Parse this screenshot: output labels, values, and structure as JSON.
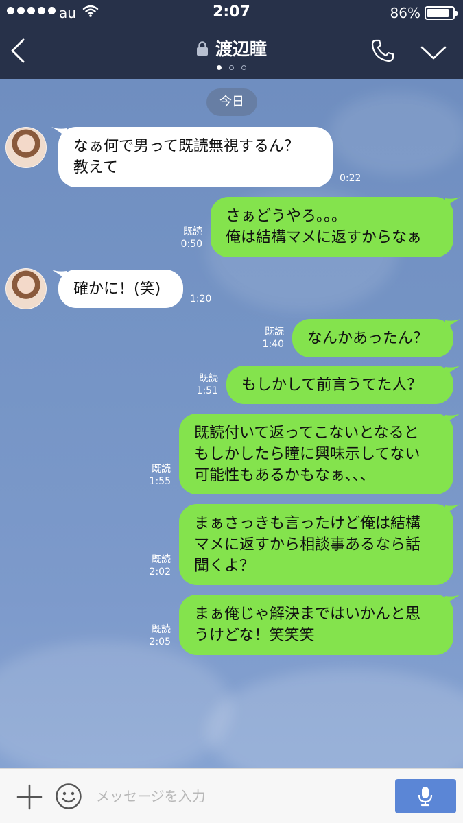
{
  "status_bar": {
    "carrier": "au",
    "time": "2:07",
    "battery": "86%",
    "battery_level": 0.86
  },
  "header": {
    "title": "渡辺瞳",
    "page_count": 3,
    "active_page": 1
  },
  "chat": {
    "date_label": "今日",
    "messages": [
      {
        "side": "in",
        "text": "なぁ何で男って既読無視するん？\n教えて",
        "time": "0:22"
      },
      {
        "side": "out",
        "read": "既読",
        "text": "さぁどうやろ。。。\n俺は結構マメに返すからなぁ",
        "time": "0:50"
      },
      {
        "side": "in",
        "text": "確かに！(笑)",
        "time": "1:20"
      },
      {
        "side": "out",
        "read": "既読",
        "text": "なんかあったん？",
        "time": "1:40"
      },
      {
        "side": "out",
        "read": "既読",
        "text": "もしかして前言うてた人？",
        "time": "1:51"
      },
      {
        "side": "out",
        "read": "既読",
        "text": "既読付いて返ってこないとなると\nもしかしたら瞳に興味示してない\n可能性もあるかもなぁ、、、",
        "time": "1:55"
      },
      {
        "side": "out",
        "read": "既読",
        "text": "まぁさっきも言ったけど俺は結構\nマメに返すから相談事あるなら話\n聞くよ？",
        "time": "2:02"
      },
      {
        "side": "out",
        "read": "既読",
        "text": "まぁ俺じゃ解決まではいかんと思\nうけどな！笑笑笑",
        "time": "2:05"
      }
    ]
  },
  "input_bar": {
    "placeholder": "メッセージを入力"
  },
  "colors": {
    "header_bg": "#273149",
    "chat_bg": "#7694c4",
    "bubble_out": "#84e34d",
    "bubble_in": "#ffffff",
    "mic_button": "#5b86d6"
  },
  "icons": [
    "wifi-icon",
    "battery-icon",
    "back-arrow-icon",
    "lock-icon",
    "phone-icon",
    "chevron-down-icon",
    "plus-icon",
    "smiley-icon",
    "microphone-icon"
  ]
}
